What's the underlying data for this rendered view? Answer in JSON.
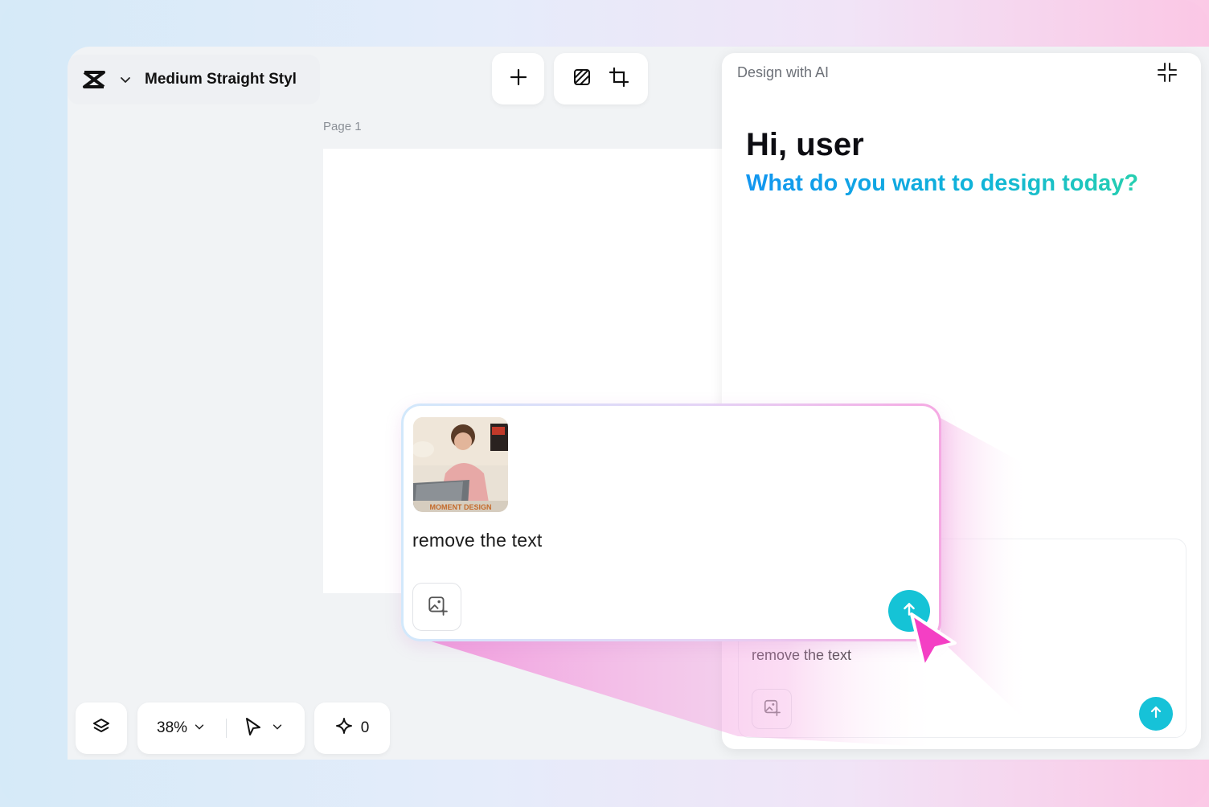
{
  "header": {
    "project_title": "Medium Straight Styl"
  },
  "canvas": {
    "page_label": "Page 1"
  },
  "bottom_toolbar": {
    "zoom_level": "38%",
    "ai_credits": "0"
  },
  "ai_panel": {
    "title": "Design with AI",
    "greeting": "Hi, user",
    "subheading": "What do you want to design today?",
    "prompt_text": "remove the text"
  },
  "callout": {
    "prompt_text": "remove the text",
    "thumbnail_caption": "MOMENT DESIGN"
  },
  "colors": {
    "accent_send": "#16c2d8",
    "subheading_start": "#1296f0",
    "subheading_end": "#26cfb0",
    "cursor": "#f43fc4"
  },
  "icons": {
    "logo": "capcut-logo-icon",
    "add": "plus-icon",
    "fill": "hatch-fill-icon",
    "resize": "resize-frame-icon",
    "layers": "layers-icon",
    "pointer": "pointer-icon",
    "sparkle": "sparkle-icon",
    "collapse": "collapse-icon",
    "add_image": "add-image-icon",
    "send": "arrow-up-icon"
  }
}
